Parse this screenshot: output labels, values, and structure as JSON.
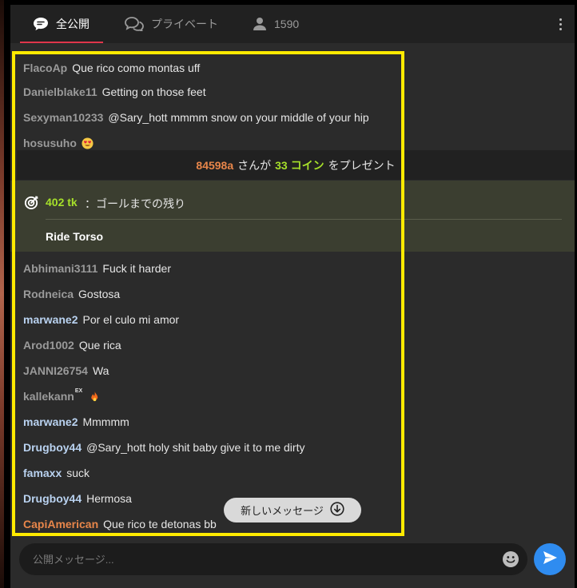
{
  "tabs": [
    {
      "label": "全公開",
      "icon": "chat-bubble-icon",
      "active": true
    },
    {
      "label": "プライベート",
      "icon": "chat-bubbles-icon",
      "active": false
    },
    {
      "label": "1590",
      "icon": "user-icon",
      "active": false
    }
  ],
  "messages_top": [
    {
      "user": "FlacoAp",
      "text": "Que rico como montas uff"
    },
    {
      "user": "Danielblake11",
      "text": "Getting on those feet"
    },
    {
      "user": "Sexyman10233",
      "text": "@Sary_hott mmmm snow on your middle of your hip"
    },
    {
      "user": "hosusuho",
      "text": "",
      "emoji": "heart-eyes-emoji"
    }
  ],
  "tip": {
    "user": "84598a",
    "pre": "さんが",
    "amount": "33 コイン",
    "post": "をプレゼント"
  },
  "goal": {
    "tokens": "402 tk",
    "label": "：ゴールまでの残り",
    "title": "Ride Torso"
  },
  "messages_bottom": [
    {
      "user": "Abhimani3111",
      "text": "Fuck it harder",
      "color": "gray"
    },
    {
      "user": "Rodneica",
      "text": "Gostosa",
      "color": "gray"
    },
    {
      "user": "marwane2",
      "text": "Por el culo mi amor",
      "color": "blue"
    },
    {
      "user": "Arod1002",
      "text": "Que rica",
      "color": "gray"
    },
    {
      "user": "JANNI26754",
      "text": "Wa",
      "color": "gray"
    },
    {
      "user": "kallekann",
      "badge": "EX",
      "text": "",
      "emoji": "fire-emoji",
      "color": "gray"
    },
    {
      "user": "marwane2",
      "text": "Mmmmm",
      "color": "blue"
    },
    {
      "user": "Drugboy44",
      "text": "@Sary_hott holy shit baby give it to me dirty",
      "color": "blue"
    },
    {
      "user": "famaxx",
      "text": "suck",
      "color": "blue"
    },
    {
      "user": "Drugboy44",
      "text": "Hermosa",
      "color": "blue"
    },
    {
      "user": "CapiAmerican",
      "text": "Que rico te detonas bb",
      "color": "orange"
    }
  ],
  "new_messages_label": "新しいメッセージ",
  "input": {
    "placeholder": "公開メッセージ..."
  },
  "colors": {
    "accent_red": "#e0364b",
    "send_blue": "#2f8cf0",
    "highlight": "#ffea00",
    "goal_green": "#a6e02a",
    "tip_orange": "#e8864a"
  }
}
